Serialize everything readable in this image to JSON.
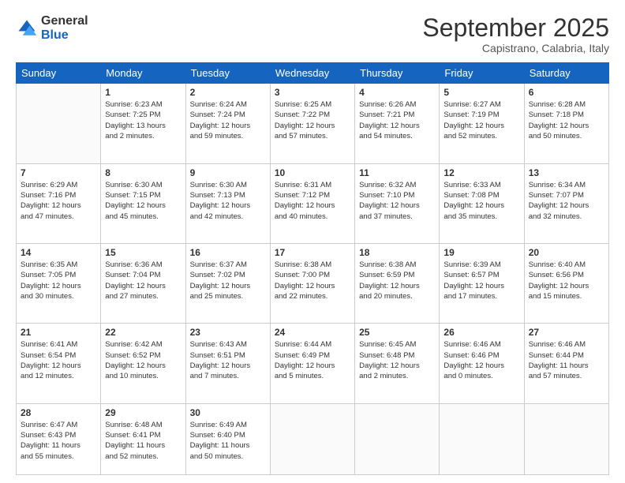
{
  "header": {
    "logo_general": "General",
    "logo_blue": "Blue",
    "month_title": "September 2025",
    "subtitle": "Capistrano, Calabria, Italy"
  },
  "days_of_week": [
    "Sunday",
    "Monday",
    "Tuesday",
    "Wednesday",
    "Thursday",
    "Friday",
    "Saturday"
  ],
  "weeks": [
    [
      {
        "day": "",
        "info": ""
      },
      {
        "day": "1",
        "info": "Sunrise: 6:23 AM\nSunset: 7:25 PM\nDaylight: 13 hours\nand 2 minutes."
      },
      {
        "day": "2",
        "info": "Sunrise: 6:24 AM\nSunset: 7:24 PM\nDaylight: 12 hours\nand 59 minutes."
      },
      {
        "day": "3",
        "info": "Sunrise: 6:25 AM\nSunset: 7:22 PM\nDaylight: 12 hours\nand 57 minutes."
      },
      {
        "day": "4",
        "info": "Sunrise: 6:26 AM\nSunset: 7:21 PM\nDaylight: 12 hours\nand 54 minutes."
      },
      {
        "day": "5",
        "info": "Sunrise: 6:27 AM\nSunset: 7:19 PM\nDaylight: 12 hours\nand 52 minutes."
      },
      {
        "day": "6",
        "info": "Sunrise: 6:28 AM\nSunset: 7:18 PM\nDaylight: 12 hours\nand 50 minutes."
      }
    ],
    [
      {
        "day": "7",
        "info": "Sunrise: 6:29 AM\nSunset: 7:16 PM\nDaylight: 12 hours\nand 47 minutes."
      },
      {
        "day": "8",
        "info": "Sunrise: 6:30 AM\nSunset: 7:15 PM\nDaylight: 12 hours\nand 45 minutes."
      },
      {
        "day": "9",
        "info": "Sunrise: 6:30 AM\nSunset: 7:13 PM\nDaylight: 12 hours\nand 42 minutes."
      },
      {
        "day": "10",
        "info": "Sunrise: 6:31 AM\nSunset: 7:12 PM\nDaylight: 12 hours\nand 40 minutes."
      },
      {
        "day": "11",
        "info": "Sunrise: 6:32 AM\nSunset: 7:10 PM\nDaylight: 12 hours\nand 37 minutes."
      },
      {
        "day": "12",
        "info": "Sunrise: 6:33 AM\nSunset: 7:08 PM\nDaylight: 12 hours\nand 35 minutes."
      },
      {
        "day": "13",
        "info": "Sunrise: 6:34 AM\nSunset: 7:07 PM\nDaylight: 12 hours\nand 32 minutes."
      }
    ],
    [
      {
        "day": "14",
        "info": "Sunrise: 6:35 AM\nSunset: 7:05 PM\nDaylight: 12 hours\nand 30 minutes."
      },
      {
        "day": "15",
        "info": "Sunrise: 6:36 AM\nSunset: 7:04 PM\nDaylight: 12 hours\nand 27 minutes."
      },
      {
        "day": "16",
        "info": "Sunrise: 6:37 AM\nSunset: 7:02 PM\nDaylight: 12 hours\nand 25 minutes."
      },
      {
        "day": "17",
        "info": "Sunrise: 6:38 AM\nSunset: 7:00 PM\nDaylight: 12 hours\nand 22 minutes."
      },
      {
        "day": "18",
        "info": "Sunrise: 6:38 AM\nSunset: 6:59 PM\nDaylight: 12 hours\nand 20 minutes."
      },
      {
        "day": "19",
        "info": "Sunrise: 6:39 AM\nSunset: 6:57 PM\nDaylight: 12 hours\nand 17 minutes."
      },
      {
        "day": "20",
        "info": "Sunrise: 6:40 AM\nSunset: 6:56 PM\nDaylight: 12 hours\nand 15 minutes."
      }
    ],
    [
      {
        "day": "21",
        "info": "Sunrise: 6:41 AM\nSunset: 6:54 PM\nDaylight: 12 hours\nand 12 minutes."
      },
      {
        "day": "22",
        "info": "Sunrise: 6:42 AM\nSunset: 6:52 PM\nDaylight: 12 hours\nand 10 minutes."
      },
      {
        "day": "23",
        "info": "Sunrise: 6:43 AM\nSunset: 6:51 PM\nDaylight: 12 hours\nand 7 minutes."
      },
      {
        "day": "24",
        "info": "Sunrise: 6:44 AM\nSunset: 6:49 PM\nDaylight: 12 hours\nand 5 minutes."
      },
      {
        "day": "25",
        "info": "Sunrise: 6:45 AM\nSunset: 6:48 PM\nDaylight: 12 hours\nand 2 minutes."
      },
      {
        "day": "26",
        "info": "Sunrise: 6:46 AM\nSunset: 6:46 PM\nDaylight: 12 hours\nand 0 minutes."
      },
      {
        "day": "27",
        "info": "Sunrise: 6:46 AM\nSunset: 6:44 PM\nDaylight: 11 hours\nand 57 minutes."
      }
    ],
    [
      {
        "day": "28",
        "info": "Sunrise: 6:47 AM\nSunset: 6:43 PM\nDaylight: 11 hours\nand 55 minutes."
      },
      {
        "day": "29",
        "info": "Sunrise: 6:48 AM\nSunset: 6:41 PM\nDaylight: 11 hours\nand 52 minutes."
      },
      {
        "day": "30",
        "info": "Sunrise: 6:49 AM\nSunset: 6:40 PM\nDaylight: 11 hours\nand 50 minutes."
      },
      {
        "day": "",
        "info": ""
      },
      {
        "day": "",
        "info": ""
      },
      {
        "day": "",
        "info": ""
      },
      {
        "day": "",
        "info": ""
      }
    ]
  ]
}
